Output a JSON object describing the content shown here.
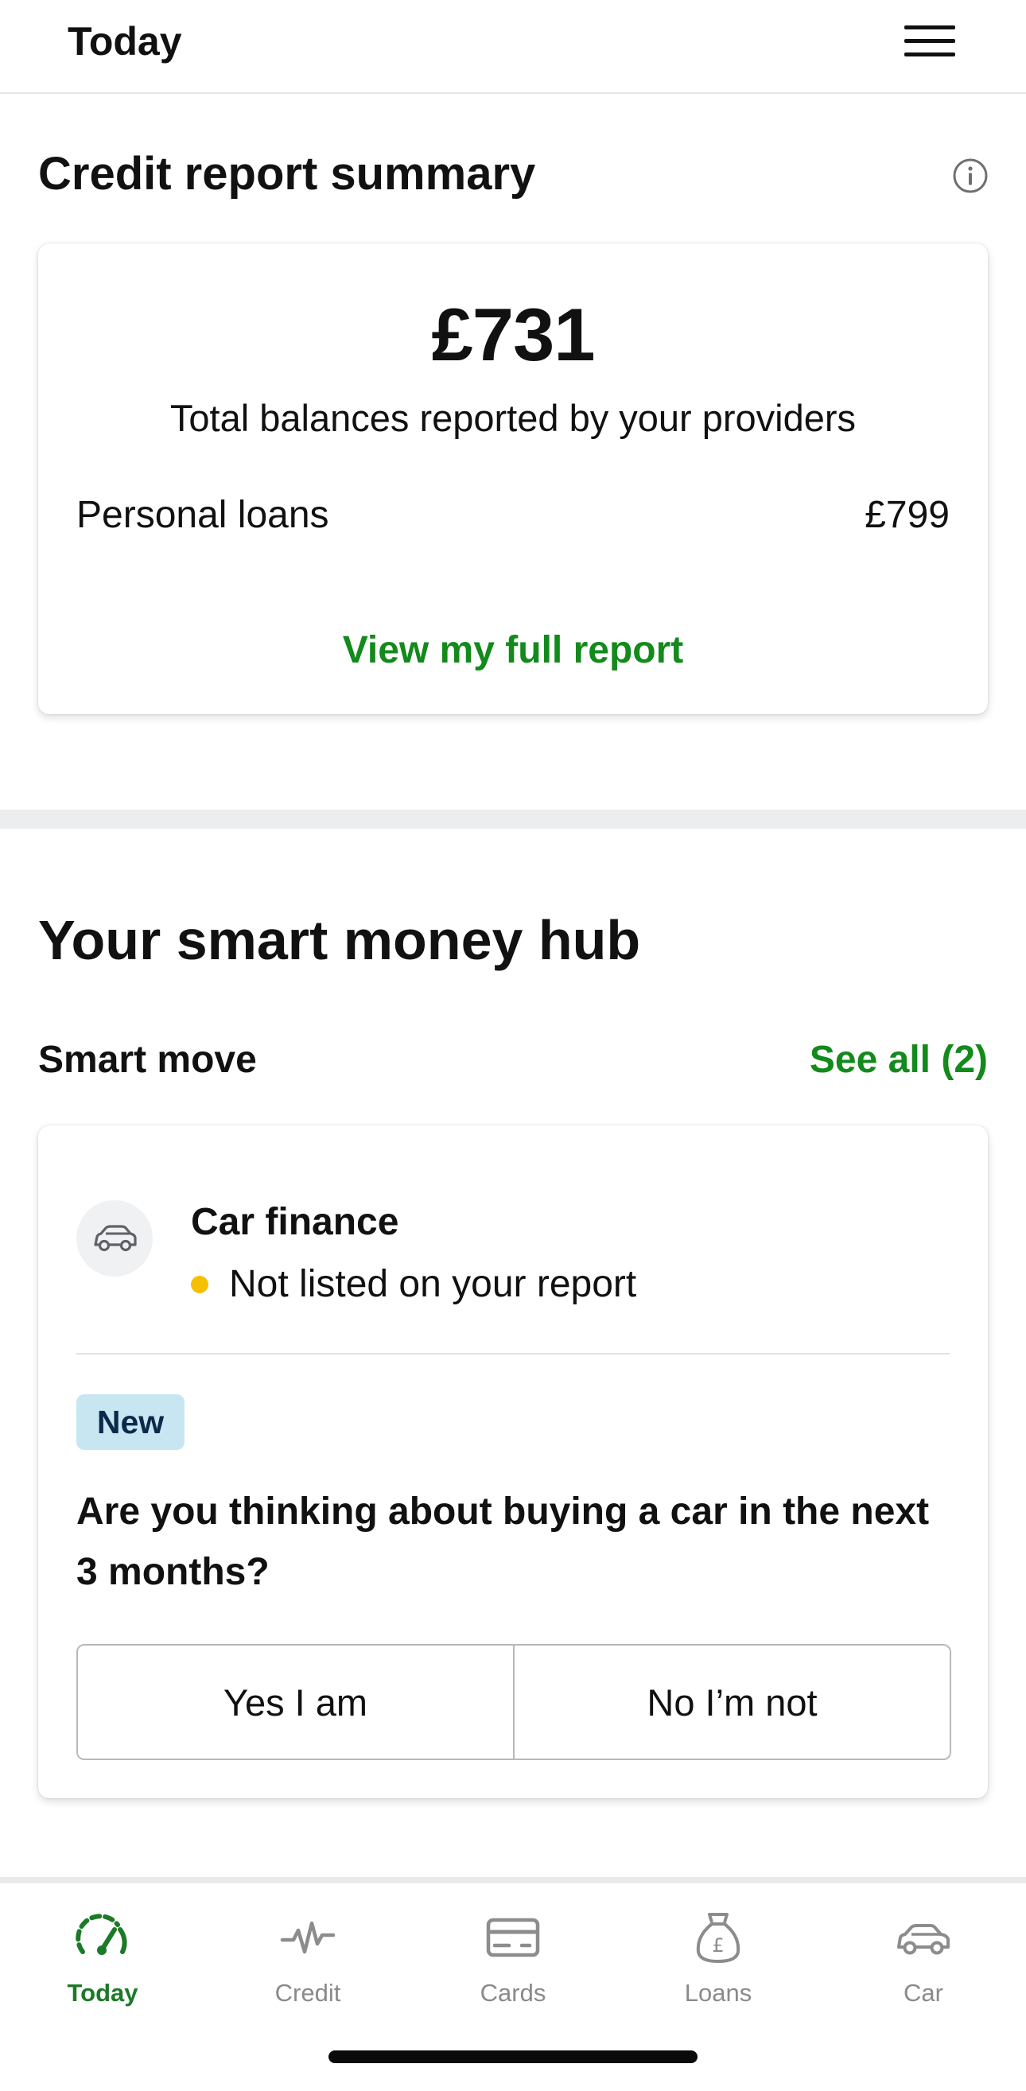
{
  "header": {
    "title": "Today",
    "menu_icon": "hamburger-menu-icon"
  },
  "credit_summary": {
    "title": "Credit report summary",
    "info_icon": "info-icon",
    "total_amount": "£731",
    "total_caption": "Total balances reported by your providers",
    "rows": [
      {
        "label": "Personal loans",
        "value": "£799"
      }
    ],
    "link": "View my full report"
  },
  "hub": {
    "title": "Your smart money hub",
    "smart_move_label": "Smart move",
    "see_all": "See all (2)",
    "card": {
      "icon": "car-icon",
      "title": "Car finance",
      "status": "Not listed on your report",
      "status_color": "#f5c000",
      "badge": "New",
      "question": "Are you thinking about buying a car in the next 3 months?",
      "options": [
        "Yes I am",
        "No I’m not"
      ]
    }
  },
  "bottom_nav": {
    "active": "Today",
    "items": [
      {
        "label": "Today",
        "icon": "speedometer-icon"
      },
      {
        "label": "Credit",
        "icon": "pulse-icon"
      },
      {
        "label": "Cards",
        "icon": "credit-card-icon"
      },
      {
        "label": "Loans",
        "icon": "money-bag-icon"
      },
      {
        "label": "Car",
        "icon": "car-icon"
      }
    ]
  },
  "colors": {
    "accent_green": "#138a1c",
    "badge_bg": "#c8e6f2",
    "divider": "#ebedef"
  }
}
